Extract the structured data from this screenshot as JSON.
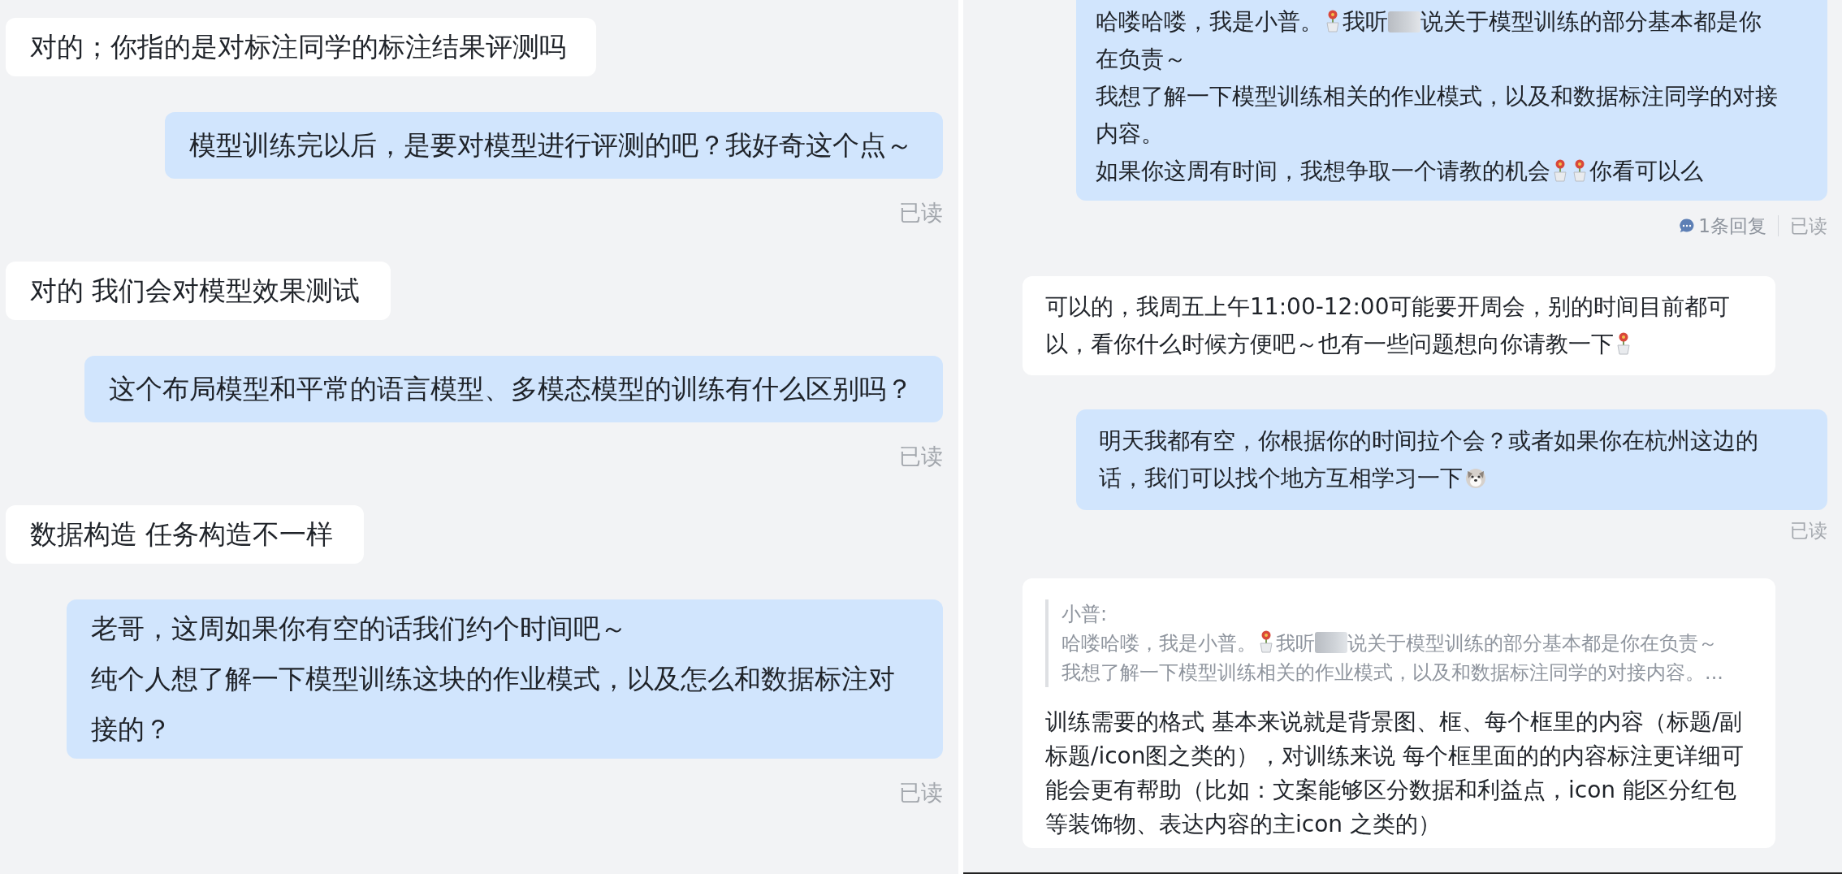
{
  "panels": [
    {
      "messages": [
        {
          "kind": "incoming",
          "paragraphs": [
            [
              {
                "kind": "text",
                "text": "对的；你指的是对标注同学的标注结果评测吗"
              }
            ]
          ]
        },
        {
          "kind": "outgoing",
          "paragraphs": [
            [
              {
                "kind": "text",
                "text": "模型训练完以后，是要对模型进行评测的吧？我好奇这个点～"
              }
            ]
          ],
          "receipt": "已读"
        },
        {
          "kind": "incoming",
          "paragraphs": [
            [
              {
                "kind": "text",
                "text": "对的 我们会对模型效果测试"
              }
            ]
          ]
        },
        {
          "kind": "outgoing",
          "paragraphs": [
            [
              {
                "kind": "text",
                "text": "这个布局模型和平常的语言模型、多模态模型的训练有什么区别吗？"
              }
            ]
          ],
          "receipt": "已读"
        },
        {
          "kind": "incoming",
          "paragraphs": [
            [
              {
                "kind": "text",
                "text": "数据构造 任务构造不一样"
              }
            ]
          ]
        },
        {
          "kind": "outgoing",
          "paragraphs": [
            [
              {
                "kind": "text",
                "text": "老哥，这周如果你有空的话我们约个时间吧～"
              }
            ],
            [
              {
                "kind": "text",
                "text": "纯个人想了解一下模型训练这块的作业模式，以及怎么和数据标注对接的？"
              }
            ]
          ],
          "receipt": "已读"
        }
      ]
    },
    {
      "messages": [
        {
          "kind": "outgoing",
          "paragraphs": [
            [
              {
                "kind": "text",
                "text": "哈喽哈喽，我是小普。"
              },
              {
                "kind": "flower"
              },
              {
                "kind": "text",
                "text": "我听"
              },
              {
                "kind": "redacted"
              },
              {
                "kind": "text",
                "text": "说关于模型训练的部分基本都是你"
              }
            ],
            [
              {
                "kind": "text",
                "text": "在负责～"
              }
            ],
            [
              {
                "kind": "text",
                "text": "我想了解一下模型训练相关的作业模式，以及和数据标注同学的对接"
              }
            ],
            [
              {
                "kind": "text",
                "text": "内容。"
              }
            ],
            [
              {
                "kind": "text",
                "text": "如果你这周有时间，我想争取一个请教的机会"
              },
              {
                "kind": "flower"
              },
              {
                "kind": "flower"
              },
              {
                "kind": "text",
                "text": "你看可以么"
              }
            ]
          ],
          "replies": "1条回复",
          "receipt": "已读"
        },
        {
          "kind": "incoming",
          "paragraphs": [
            [
              {
                "kind": "text",
                "text": "可以的，我周五上午11:00-12:00可能要开周会，别的时间目前都可"
              }
            ],
            [
              {
                "kind": "text",
                "text": "以，看你什么时候方便吧～也有一些问题想向你请教一下"
              },
              {
                "kind": "flower"
              }
            ]
          ]
        },
        {
          "kind": "outgoing",
          "paragraphs": [
            [
              {
                "kind": "text",
                "text": "明天我都有空，你根据你的时间拉个会？或者如果你在杭州这边的"
              }
            ],
            [
              {
                "kind": "text",
                "text": "话，我们可以找个地方互相学习一下"
              },
              {
                "kind": "dog"
              }
            ]
          ],
          "receipt": "已读"
        },
        {
          "kind": "incoming",
          "quote": {
            "author": "小普:",
            "lines": [
              [
                {
                  "kind": "text",
                  "text": "哈喽哈喽，我是小普。"
                },
                {
                  "kind": "flower"
                },
                {
                  "kind": "text",
                  "text": "我听"
                },
                {
                  "kind": "redacted"
                },
                {
                  "kind": "text",
                  "text": "说关于模型训练的部分基本都是你在负责～"
                }
              ],
              [
                {
                  "kind": "text",
                  "text": "我想了解一下模型训练相关的作业模式，以及和数据标注同学的对接内容。..."
                }
              ]
            ]
          },
          "paragraphs": [
            [
              {
                "kind": "text",
                "text": "训练需要的格式 基本来说就是背景图、框、每个框里的内容（标题/副标题/icon图之类的），对训练来说 每个框里面的的内容标注更详细可能会更有帮助（比如：文案能够区分数据和利益点，icon 能区分红包等装饰物、表达内容的主icon 之类的）"
              }
            ]
          ]
        }
      ]
    }
  ]
}
